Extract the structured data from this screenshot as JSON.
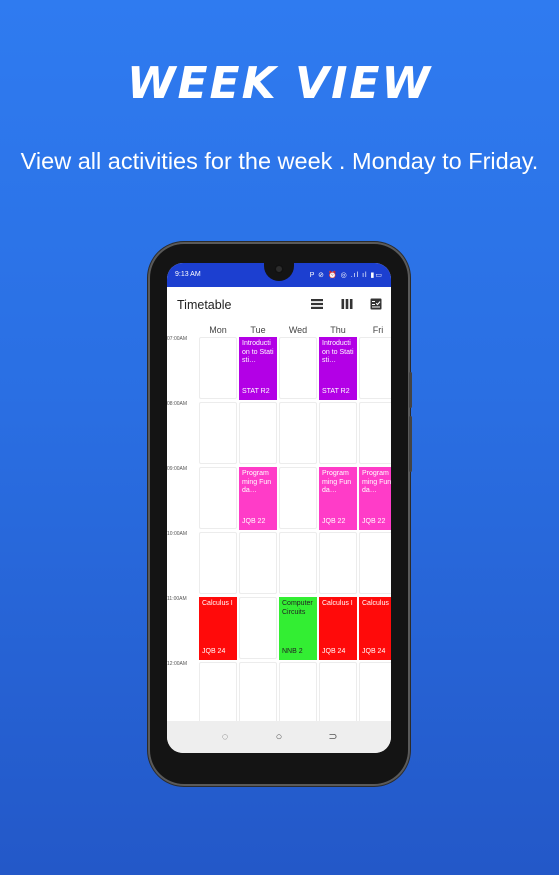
{
  "headline": "WEEK VIEW",
  "subline": "View all activities for the week . Monday to Friday.",
  "status": {
    "time": "9:13 AM",
    "icons": "P ⊘   ⏰ ◎ .ıl ıl ▮▭"
  },
  "app": {
    "title": "Timetable",
    "toolbar_icons": [
      "day-view-icon",
      "week-view-icon",
      "checklist-icon"
    ]
  },
  "days": [
    "Mon",
    "Tue",
    "Wed",
    "Thu",
    "Fri"
  ],
  "times": [
    "07:00AM",
    "08:00AM",
    "09:00AM",
    "10:00AM",
    "11:00AM",
    "12:00AM"
  ],
  "events": [
    {
      "name": "Introduction to Statisti…",
      "room": "STAT R2",
      "color": "#b300e6",
      "day": 1,
      "slot": 0
    },
    {
      "name": "Introduction to Statisti…",
      "room": "STAT R2",
      "color": "#b300e6",
      "day": 3,
      "slot": 0
    },
    {
      "name": "Programming Funda…",
      "room": "JQB 22",
      "color": "#ff3cc8",
      "day": 1,
      "slot": 2
    },
    {
      "name": "Programming Funda…",
      "room": "JQB 22",
      "color": "#ff3cc8",
      "day": 3,
      "slot": 2
    },
    {
      "name": "Programming Funda…",
      "room": "JQB 22",
      "color": "#ff3cc8",
      "day": 4,
      "slot": 2
    },
    {
      "name": "Calculus I",
      "room": "JQB 24",
      "color": "#ff0a0a",
      "day": 0,
      "slot": 4
    },
    {
      "name": "Computer Circuits",
      "room": "NNB 2",
      "color": "#33ee33",
      "day": 2,
      "slot": 4,
      "dark": true
    },
    {
      "name": "Calculus I",
      "room": "JQB 24",
      "color": "#ff0a0a",
      "day": 3,
      "slot": 4
    },
    {
      "name": "Calculus I",
      "room": "JQB 24",
      "color": "#ff0a0a",
      "day": 4,
      "slot": 4
    }
  ],
  "nav": {
    "recents": "◌",
    "home": "○",
    "back": "⊃"
  }
}
